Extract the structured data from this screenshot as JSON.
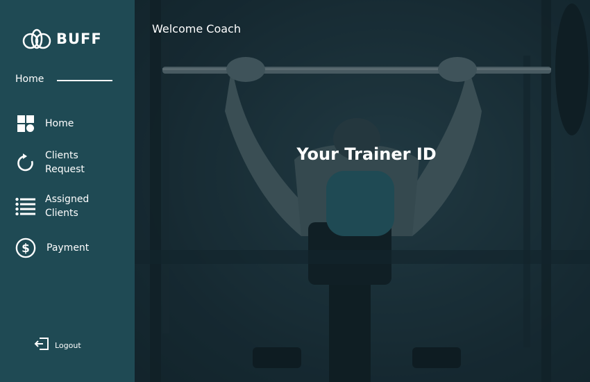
{
  "brand": {
    "name": "BUFF"
  },
  "breadcrumb": {
    "label": "Home"
  },
  "nav": {
    "items": [
      {
        "label": "Home",
        "icon": "dashboard-icon"
      },
      {
        "label": "Clients Request",
        "icon": "refresh-icon"
      },
      {
        "label": "Assigned Clients",
        "icon": "list-icon"
      },
      {
        "label": "Payment",
        "icon": "dollar-circle-icon"
      }
    ]
  },
  "logout": {
    "label": "Logout",
    "icon": "logout-icon"
  },
  "header": {
    "welcome": "Welcome Coach"
  },
  "trainer": {
    "title": "Your Trainer ID",
    "id_value": ""
  },
  "colors": {
    "sidebar": "#1f4a54",
    "id_box": "#1f4a54",
    "text": "#ffffff"
  }
}
